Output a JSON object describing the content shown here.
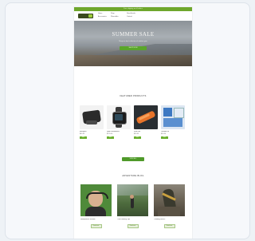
{
  "announcement": "Free shipping on all orders",
  "header": {
    "logo": "WOLFBIT",
    "nav": [
      "Home",
      "Shop",
      "New Arrivals",
      "Accessories",
      "Wearables",
      "Contact"
    ]
  },
  "hero": {
    "title": "SUMMER SALE",
    "subtitle": "Shop our best collection of outdoor gear",
    "button": "SHOP NOW"
  },
  "featured": {
    "title": "FEATURED PRODUCTS",
    "products": [
      {
        "name": "Backpack",
        "price": "$49.99",
        "button": "Add"
      },
      {
        "name": "Sport Smartwatch",
        "price": "$129.00",
        "button": "Add"
      },
      {
        "name": "Knife Set",
        "price": "$39.99",
        "button": "Add"
      },
      {
        "name": "Outdoor Kit",
        "price": "$24.50",
        "button": "Add"
      }
    ],
    "view_all": "VIEW ALL"
  },
  "blog": {
    "title": "ADVENTURE BLOG",
    "posts": [
      {
        "title": "Headphones Review",
        "button": "Read more"
      },
      {
        "title": "Trail Running Tips",
        "button": "Read more"
      },
      {
        "title": "Climbing Basics",
        "button": "Read more"
      }
    ]
  },
  "colors": {
    "accent": "#5aa62a",
    "announcement_bar": "#6ea72c"
  }
}
